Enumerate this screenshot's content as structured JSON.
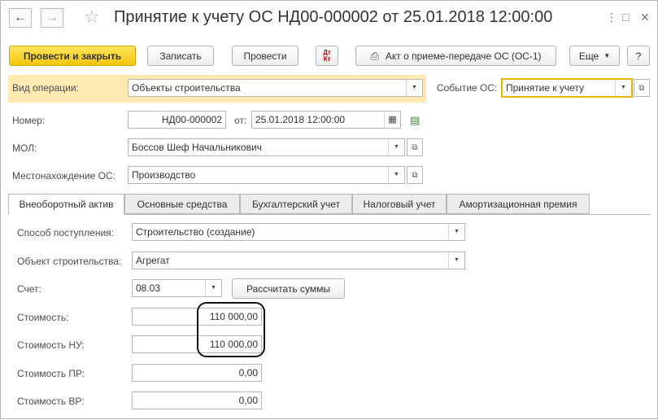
{
  "window": {
    "title": "Принятие к учету ОС НД00-000002 от 25.01.2018 12:00:00",
    "back_icon": "arrow-left-icon",
    "forward_icon": "arrow-right-icon",
    "favorite_icon": "star-icon",
    "more_icon": "vertical-dots-icon",
    "maximize_icon": "maximize-icon",
    "close_icon": "close-icon"
  },
  "toolbar": {
    "post_and_close": "Провести и закрыть",
    "save": "Записать",
    "post": "Провести",
    "dtkt_top": "Дт",
    "dtkt_bottom": "Кт",
    "act_print": "Акт о приеме-передаче ОС (ОС-1)",
    "more": "Еще",
    "help": "?"
  },
  "header": {
    "operation_label": "Вид операции:",
    "operation_value": "Объекты строительства",
    "event_label": "Событие ОС:",
    "event_value": "Принятие к учету",
    "number_label": "Номер:",
    "number_value": "НД00-000002",
    "date_label": "от:",
    "date_value": "25.01.2018 12:00:00",
    "mol_label": "МОЛ:",
    "mol_value": "Боссов Шеф Начальникович",
    "location_label": "Местонахождение ОС:",
    "location_value": "Производство"
  },
  "tabs": [
    {
      "label": "Внеоборотный актив",
      "active": true
    },
    {
      "label": "Основные средства",
      "active": false
    },
    {
      "label": "Бухгалтерский учет",
      "active": false
    },
    {
      "label": "Налоговый учет",
      "active": false
    },
    {
      "label": "Амортизационная премия",
      "active": false
    }
  ],
  "asset": {
    "receipt_method_label": "Способ поступления:",
    "receipt_method_value": "Строительство (создание)",
    "construction_object_label": "Объект строительства:",
    "construction_object_value": "Агрегат",
    "account_label": "Счет:",
    "account_value": "08.03",
    "calc_button": "Рассчитать суммы",
    "cost_label": "Стоимость:",
    "cost_value": "110 000,00",
    "cost_nu_label": "Стоимость НУ:",
    "cost_nu_value": "110 000,00",
    "cost_pr_label": "Стоимость ПР:",
    "cost_pr_value": "0,00",
    "cost_vr_label": "Стоимость ВР:",
    "cost_vr_value": "0,00"
  },
  "colors": {
    "primary_button": "#f3c60d",
    "highlight_row": "#fde9b1",
    "focused_field_border": "#e8b600"
  }
}
